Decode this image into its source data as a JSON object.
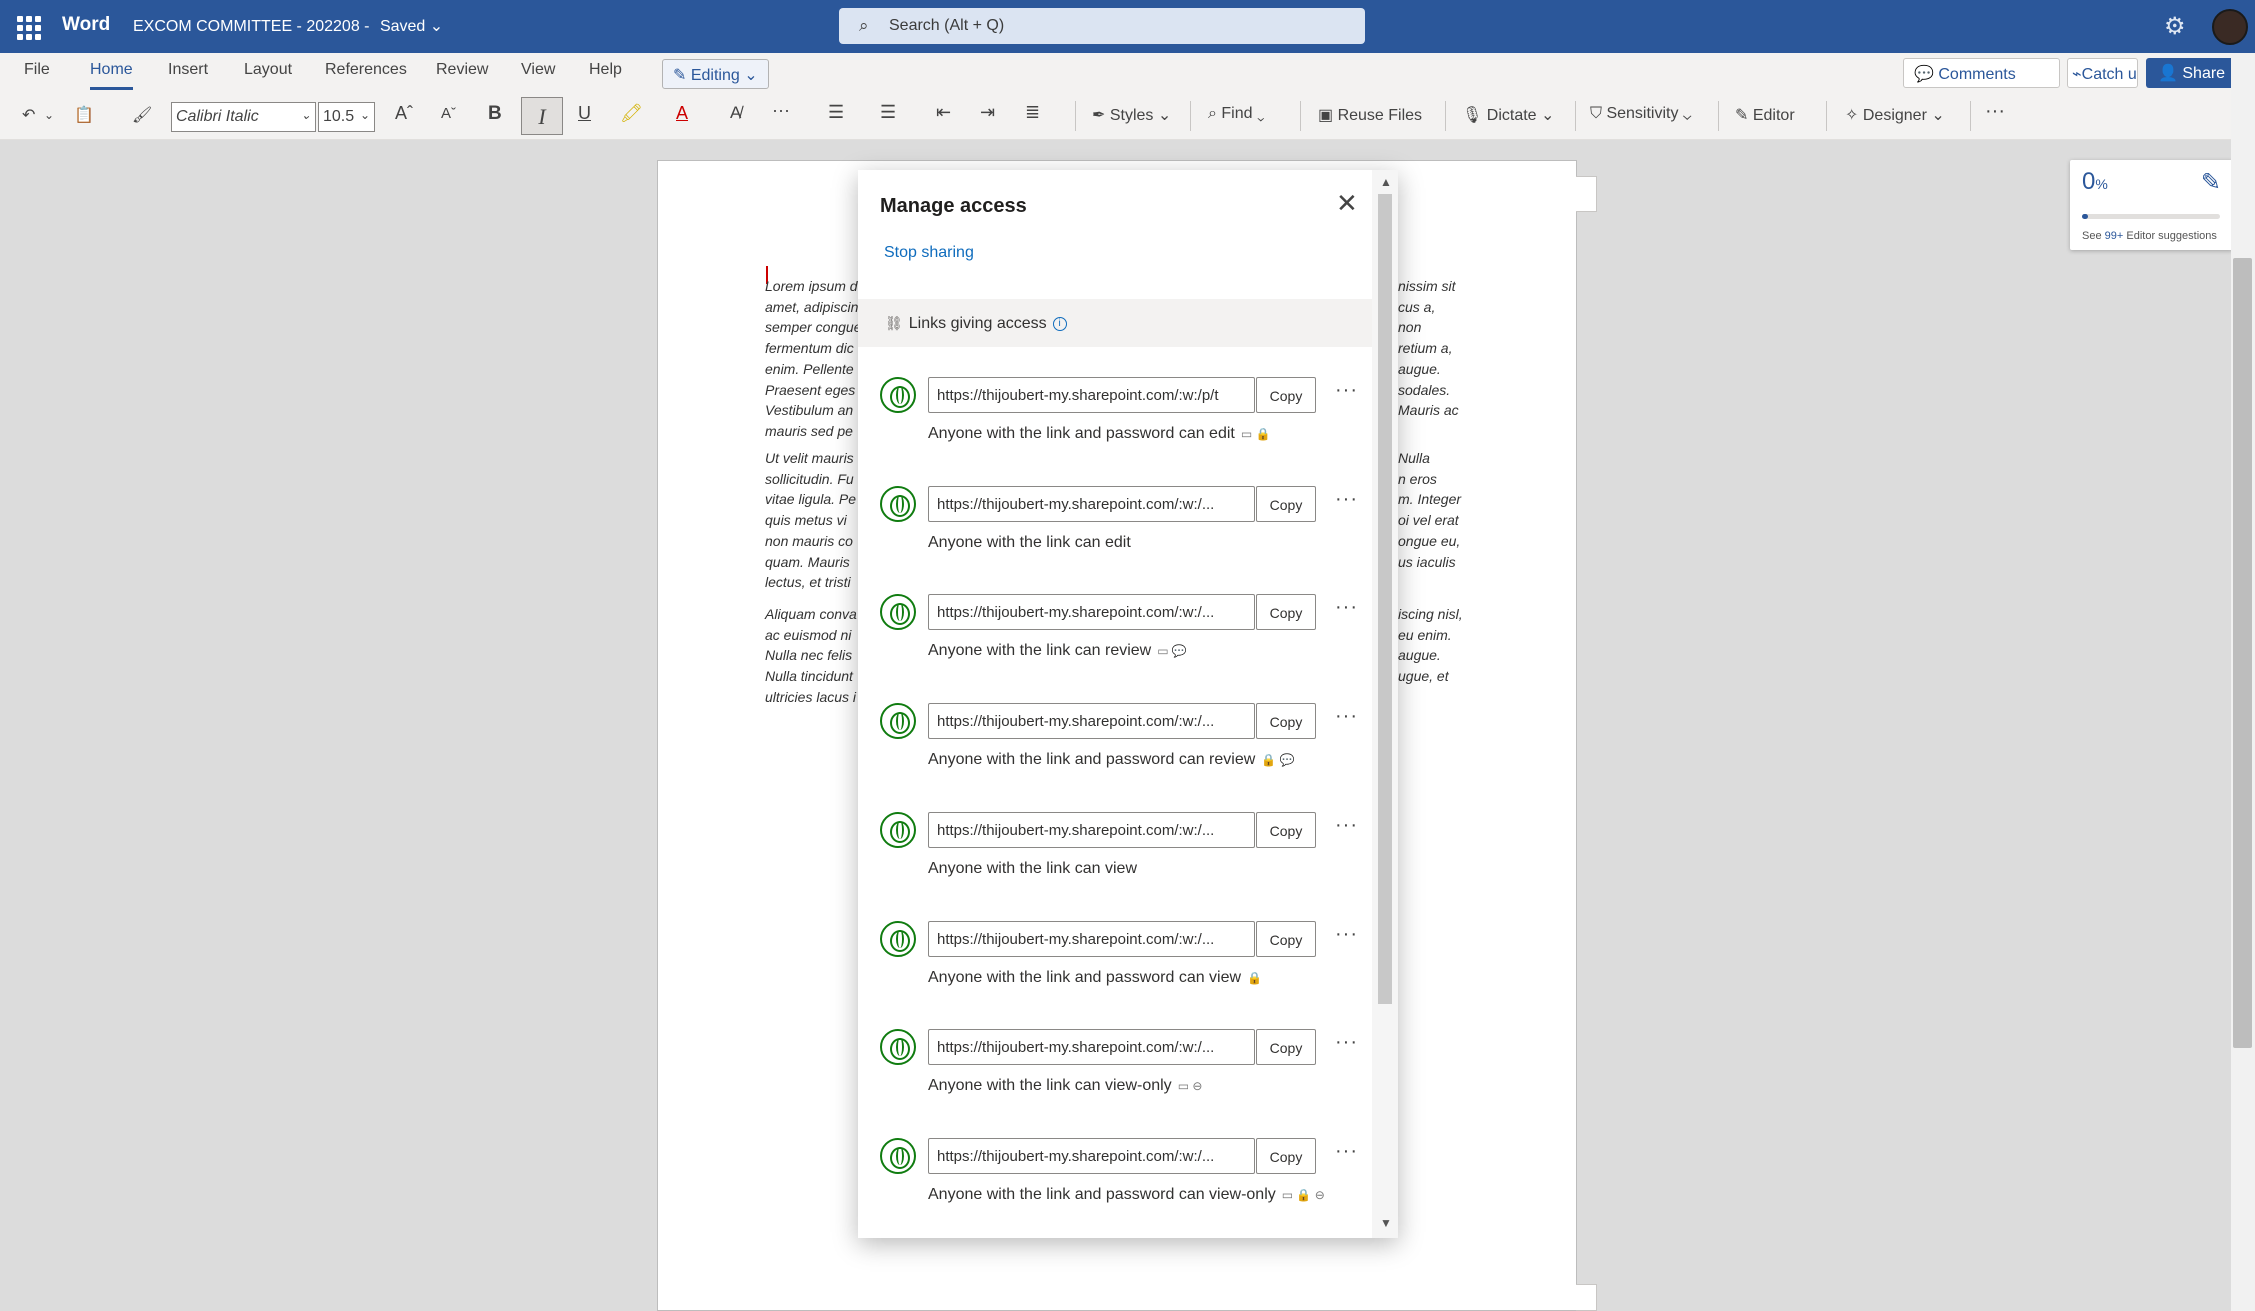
{
  "app": {
    "name": "Word",
    "doc_title": "EXCOM COMMITTEE - 202208",
    "status": "Saved"
  },
  "search": {
    "placeholder": "Search (Alt + Q)"
  },
  "tabs": [
    "File",
    "Home",
    "Insert",
    "Layout",
    "References",
    "Review",
    "View",
    "Help"
  ],
  "active_tab": "Home",
  "mode": {
    "label": "Editing"
  },
  "header_buttons": {
    "comments": "Comments",
    "catch_up": "Catch up",
    "share": "Share"
  },
  "ribbon": {
    "font": "Calibri Italic",
    "size": "10.5",
    "styles": "Styles",
    "find": "Find",
    "reuse": "Reuse Files",
    "dictate": "Dictate",
    "sensitivity": "Sensitivity",
    "editor": "Editor",
    "designer": "Designer"
  },
  "editor_pane": {
    "percent": "0",
    "suggestions_prefix": "See",
    "suggestions_count": "99+",
    "suggestions_suffix": "Editor suggestions"
  },
  "document": {
    "para1": [
      {
        "l": "Lorem ipsum d",
        "r": "nissim sit"
      },
      {
        "l": "amet, adipiscin",
        "r": "cus a,"
      },
      {
        "l": "semper congue",
        "r": "non"
      },
      {
        "l": "fermentum dic",
        "r": "retium a,"
      },
      {
        "l": "enim. Pellente",
        "r": "augue."
      },
      {
        "l": "Praesent eges",
        "r": "sodales."
      },
      {
        "l": "Vestibulum an",
        "r": "Mauris ac"
      },
      {
        "l": "mauris sed pe",
        "r": ""
      }
    ],
    "para2": [
      {
        "l": "Ut velit mauris",
        "r": "Nulla"
      },
      {
        "l": "sollicitudin. Fu",
        "r": "n eros"
      },
      {
        "l": "vitae ligula. Pe",
        "r": "m. Integer"
      },
      {
        "l": "quis metus vi",
        "r": "oi vel erat"
      },
      {
        "l": "non mauris co",
        "r": "ongue eu,"
      },
      {
        "l": "quam. Mauris",
        "r": "us iaculis"
      },
      {
        "l": "lectus, et tristi",
        "r": ""
      }
    ],
    "para3": [
      {
        "l": "Aliquam conva",
        "r": "iscing nisl,"
      },
      {
        "l": "ac euismod ni",
        "r": "eu enim."
      },
      {
        "l": "Nulla nec felis",
        "r": "augue."
      },
      {
        "l": "Nulla tincidunt",
        "r": "ugue, et"
      },
      {
        "l": "ultricies lacus i",
        "r": ""
      }
    ]
  },
  "dialog": {
    "title": "Manage access",
    "stop_sharing": "Stop sharing",
    "links_header": "Links giving access",
    "copy_label": "Copy",
    "links": [
      {
        "url": "https://thijoubert-my.sharepoint.com/:w:/p/t",
        "permission": "Anyone with the link and password can edit",
        "icons": "▭ 🔒"
      },
      {
        "url": "https://thijoubert-my.sharepoint.com/:w:/...",
        "permission": "Anyone with the link can edit",
        "icons": ""
      },
      {
        "url": "https://thijoubert-my.sharepoint.com/:w:/...",
        "permission": "Anyone with the link can review",
        "icons": "▭ 💬"
      },
      {
        "url": "https://thijoubert-my.sharepoint.com/:w:/...",
        "permission": "Anyone with the link and password can review",
        "icons": "🔒 💬"
      },
      {
        "url": "https://thijoubert-my.sharepoint.com/:w:/...",
        "permission": "Anyone with the link can view",
        "icons": ""
      },
      {
        "url": "https://thijoubert-my.sharepoint.com/:w:/...",
        "permission": "Anyone with the link and password can view",
        "icons": "🔒"
      },
      {
        "url": "https://thijoubert-my.sharepoint.com/:w:/...",
        "permission": "Anyone with the link can view-only",
        "icons": "▭ ⊖"
      },
      {
        "url": "https://thijoubert-my.sharepoint.com/:w:/...",
        "permission": "Anyone with the link and password can view-only",
        "icons": "▭ 🔒 ⊖"
      }
    ]
  }
}
